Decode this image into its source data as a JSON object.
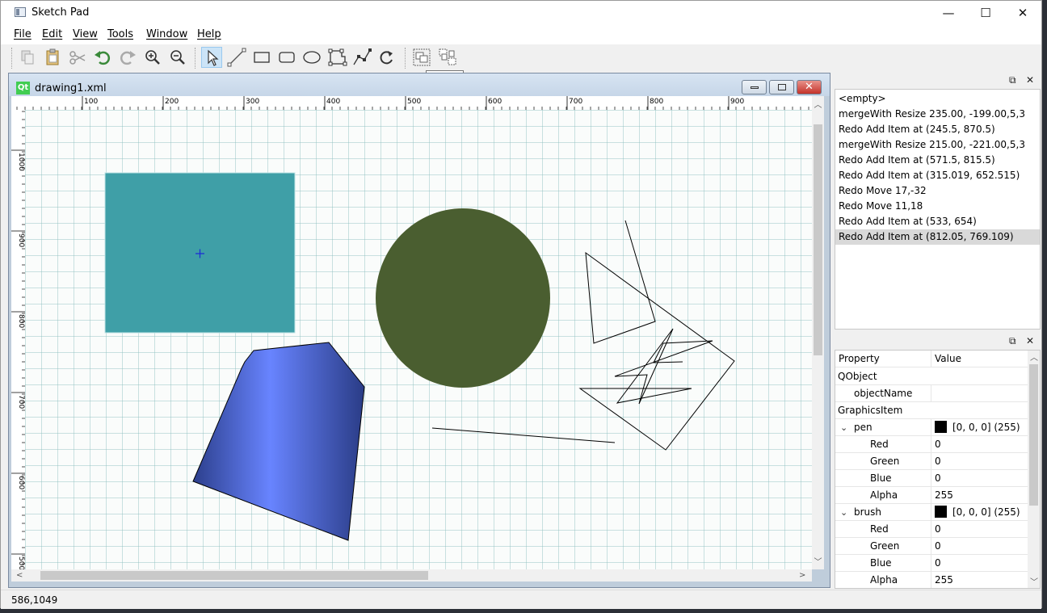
{
  "window": {
    "title": "Sketch Pad",
    "minimize": "—",
    "maximize": "☐",
    "close": "✕"
  },
  "menu": {
    "file": "File",
    "edit": "Edit",
    "view": "View",
    "tools": "Tools",
    "window": "Window",
    "help": "Help"
  },
  "toolbar": {
    "tooltip": "group",
    "icons": [
      "copy-icon",
      "paste-icon",
      "cut-icon",
      "undo-icon",
      "redo-icon",
      "zoom-in-icon",
      "zoom-out-icon",
      "select-pointer-icon",
      "line-tool-icon",
      "rectangle-tool-icon",
      "rounded-rect-tool-icon",
      "ellipse-tool-icon",
      "polygon-tool-icon",
      "polyline-tool-icon",
      "rotate-icon",
      "group-icon",
      "ungroup-icon"
    ],
    "accent": "#3a8a3a"
  },
  "document": {
    "title": "drawing1.xml",
    "logo": "Qt"
  },
  "rulers": {
    "horizontal": [
      "100",
      "200",
      "300",
      "400",
      "500",
      "600",
      "700",
      "800",
      "900"
    ],
    "vertical": [
      "1000",
      "900",
      "800",
      "700",
      "600",
      "500"
    ]
  },
  "canvas": {
    "rect_color": "#3f9fa7",
    "circle_color": "#4a5e30",
    "polygon_gradient": [
      "#2c3f8c",
      "#6884ff",
      "#2a3c86"
    ]
  },
  "status": {
    "coords": "586,1049"
  },
  "undo_dock": {
    "items": [
      "<empty>",
      " mergeWith Resize   235.00, -199.00,5,3",
      "Redo Add Item at (245.5, 870.5)",
      " mergeWith Resize   215.00, -221.00,5,3",
      "Redo Add Item at (571.5, 815.5)",
      "Redo Add Item at (315.019, 652.515)",
      "Redo Move 17,-32",
      "Redo Move 11,18",
      "Redo Add Item at (533, 654)",
      "Redo Add Item at (812.05, 769.109)"
    ],
    "selected_index": 9
  },
  "properties": {
    "header": {
      "name": "Property",
      "value": "Value"
    },
    "rows": [
      {
        "name": "QObject",
        "value": "",
        "indent": 0,
        "group": true
      },
      {
        "name": "objectName",
        "value": "",
        "indent": 1
      },
      {
        "name": "GraphicsItem",
        "value": "",
        "indent": 0,
        "group": true
      },
      {
        "name": "pen",
        "value": "[0, 0, 0] (255)",
        "indent": 1,
        "expand": true,
        "swatch": true
      },
      {
        "name": "Red",
        "value": "0",
        "indent": 2
      },
      {
        "name": "Green",
        "value": "0",
        "indent": 2
      },
      {
        "name": "Blue",
        "value": "0",
        "indent": 2
      },
      {
        "name": "Alpha",
        "value": "255",
        "indent": 2
      },
      {
        "name": "brush",
        "value": "[0, 0, 0] (255)",
        "indent": 1,
        "expand": true,
        "swatch": true
      },
      {
        "name": "Red",
        "value": "0",
        "indent": 2
      },
      {
        "name": "Green",
        "value": "0",
        "indent": 2
      },
      {
        "name": "Blue",
        "value": "0",
        "indent": 2
      },
      {
        "name": "Alpha",
        "value": "255",
        "indent": 2
      }
    ]
  }
}
